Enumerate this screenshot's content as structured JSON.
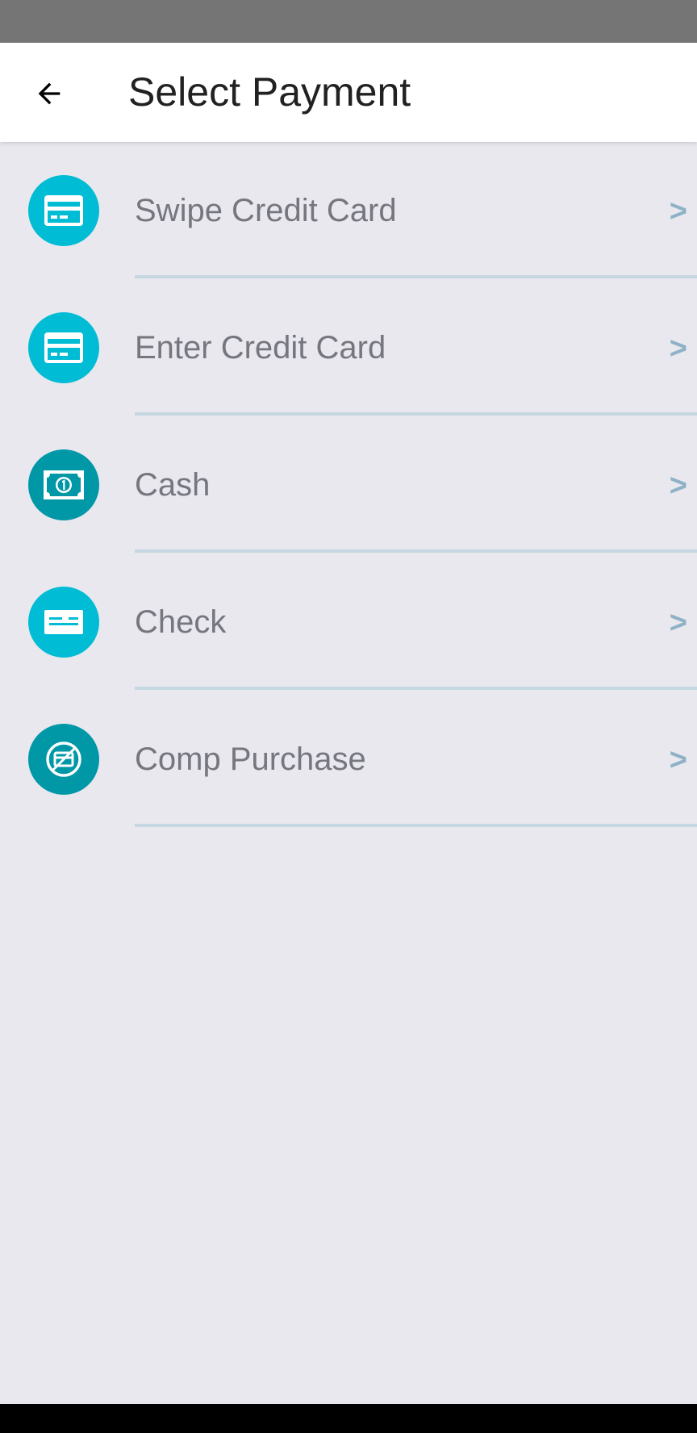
{
  "header": {
    "title": "Select Payment",
    "back_icon": "arrow-left-icon"
  },
  "colors": {
    "status_bar": "#757575",
    "app_bar": "#ffffff",
    "background": "#e8e8ee",
    "icon_light": "#00bcd4",
    "icon_dark": "#0097a7",
    "label": "#767680",
    "chevron": "#8fb1c6",
    "divider": "#c5d7e0",
    "nav_bar": "#000000"
  },
  "payment_options": [
    {
      "label": "Swipe Credit Card",
      "icon": "credit-card-icon",
      "chevron": ">"
    },
    {
      "label": "Enter Credit Card",
      "icon": "credit-card-icon",
      "chevron": ">"
    },
    {
      "label": "Cash",
      "icon": "cash-icon",
      "chevron": ">"
    },
    {
      "label": "Check",
      "icon": "check-icon",
      "chevron": ">"
    },
    {
      "label": "Comp Purchase",
      "icon": "comp-purchase-icon",
      "chevron": ">"
    }
  ]
}
